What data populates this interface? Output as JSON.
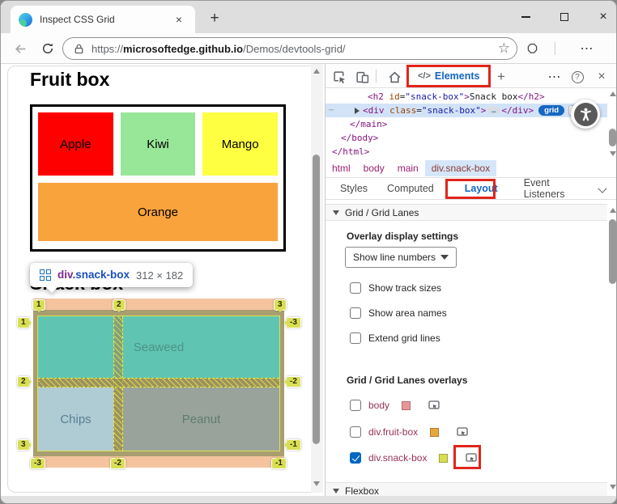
{
  "colors": {
    "accent_blue": "#1566c0",
    "annotation_red": "#e1251b",
    "selected_row": "#d2e3f7",
    "overlay_peach": "#f5c49f",
    "overlay_olive": "#a89e6f",
    "overlay_badge": "#d9df55",
    "seaweed_bg": "#5fc5b2",
    "chips_bg": "#afcbd4",
    "peanut_bg": "#99a39c"
  },
  "icons": {
    "close_glyph": "×",
    "new_tab_glyph": "+",
    "more_glyph": "⋯",
    "help_glyph": "?",
    "star_glyph": "☆",
    "ellipsis_glyph": "…",
    "hidden_marker": "⋯"
  },
  "browser": {
    "tab_title": "Inspect CSS Grid",
    "url": {
      "scheme": "https://",
      "domain": "microsoftedge.github.io",
      "path": "/Demos/devtools-grid/"
    }
  },
  "page": {
    "fruit": {
      "heading": "Fruit box",
      "items": [
        {
          "label": "Apple",
          "color": "#fe0000"
        },
        {
          "label": "Kiwi",
          "color": "#98e698"
        },
        {
          "label": "Mango",
          "color": "#ffff42"
        },
        {
          "label": "Orange",
          "color": "#f9a33c"
        }
      ]
    },
    "tooltip": {
      "tag": "div",
      "cls": ".snack-box",
      "dims": "312 × 182"
    },
    "snack": {
      "heading": "Snack box",
      "cells": [
        {
          "label": "Seaweed",
          "color": "#4f9187"
        },
        {
          "label": "Chips",
          "color": "#5a7e93"
        },
        {
          "label": "Peanut",
          "color": "#5d7d6d"
        }
      ],
      "lines": {
        "top": [
          "1",
          "2",
          "3"
        ],
        "left": [
          "1",
          "2",
          "3"
        ],
        "right": [
          "-3",
          "-2",
          "-1"
        ],
        "bottom": [
          "-3",
          "-2",
          "-1"
        ]
      }
    }
  },
  "devtools": {
    "toolbar": {
      "code_glyph": "</>",
      "elements_tab": "Elements"
    },
    "dom": {
      "l1": {
        "a": "<h2",
        "b": " id",
        "c": "=",
        "d": "\"snack-box\"",
        "e": ">",
        "f": "Snack box",
        "g": "</h2>"
      },
      "l2": {
        "a": "<div",
        "b": " class",
        "c": "=",
        "d": "\"snack-box\"",
        "e": ">",
        "f": "</div>",
        "badge": "grid"
      },
      "l3": "</main>",
      "l4": "</body>",
      "l5": "</html>"
    },
    "breadcrumbs": [
      "html",
      "body",
      "main",
      "div.snack-box"
    ],
    "tabs": [
      "Styles",
      "Computed",
      "Layout",
      "Event Listeners"
    ],
    "layout": {
      "section_grid": "Grid / Grid Lanes",
      "overlay_settings": "Overlay display settings",
      "dropdown_value": "Show line numbers",
      "checkboxes": [
        "Show track sizes",
        "Show area names",
        "Extend grid lines"
      ],
      "overlays_heading": "Grid / Grid Lanes overlays",
      "overlays": [
        {
          "label": "body",
          "checked": false,
          "swatch": "#e8969c"
        },
        {
          "label": "div.fruit-box",
          "checked": false,
          "swatch": "#e7a73f"
        },
        {
          "label": "div.snack-box",
          "checked": true,
          "swatch": "#d7de50"
        }
      ],
      "section_flexbox": "Flexbox"
    }
  }
}
